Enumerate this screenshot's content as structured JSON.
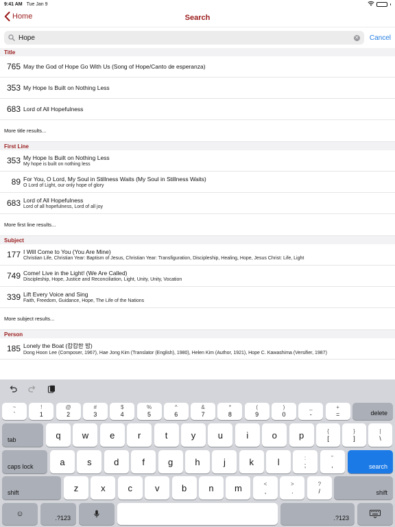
{
  "status_bar": {
    "time": "9:41 AM",
    "date": "Tue Jan 9"
  },
  "nav": {
    "back_label": "Home",
    "title": "Search"
  },
  "search": {
    "value": "Hope",
    "cancel_label": "Cancel"
  },
  "sections": [
    {
      "header": "Title",
      "rows": [
        {
          "num": "765",
          "title": "May the God of Hope Go With Us (Song of Hope/Canto de esperanza)",
          "sub": ""
        },
        {
          "num": "353",
          "title": "My Hope Is Built on Nothing Less",
          "sub": ""
        },
        {
          "num": "683",
          "title": "Lord of All Hopefulness",
          "sub": ""
        }
      ],
      "more": "More title results..."
    },
    {
      "header": "First Line",
      "rows": [
        {
          "num": "353",
          "title": "My Hope Is Built on Nothing Less",
          "sub": "My hope is built on nothing less"
        },
        {
          "num": "89",
          "title": "For You, O Lord, My Soul in Stillness Waits (My Soul in Stillness Waits)",
          "sub": "O Lord of Light, our only hope of glory"
        },
        {
          "num": "683",
          "title": "Lord of All Hopefulness",
          "sub": "Lord of all hopefulness, Lord of all joy"
        }
      ],
      "more": "More first line results..."
    },
    {
      "header": "Subject",
      "rows": [
        {
          "num": "177",
          "title": "I Will Come to You (You Are Mine)",
          "sub": "Christian Life, Christian Year: Baptism of Jesus, Christian Year: Transfiguration, Discipleship, Healing, Hope, Jesus Christ: Life, Light"
        },
        {
          "num": "749",
          "title": "Come! Live in the Light! (We Are Called)",
          "sub": "Discipleship, Hope, Justice and Reconciliation, Light, Unity, Unity, Vocation"
        },
        {
          "num": "339",
          "title": "Lift Every Voice and Sing",
          "sub": "Faith, Freedom, Guidance, Hope, The Life of the Nations"
        }
      ],
      "more": "More subject results..."
    },
    {
      "header": "Person",
      "rows": [
        {
          "num": "185",
          "title": "Lonely the Boat (캄캄한 밤)",
          "sub": "Dong Hoon Lee (Composer, 1967), Hae Jong Kim (Translator (English), 1980), Helen Kim (Author, 1921), Hope C. Kawashima (Versifier, 1987)"
        }
      ],
      "more": ""
    }
  ],
  "keyboard": {
    "row1": [
      {
        "top": "~",
        "bot": "`"
      },
      {
        "top": "!",
        "bot": "1"
      },
      {
        "top": "@",
        "bot": "2"
      },
      {
        "top": "#",
        "bot": "3"
      },
      {
        "top": "$",
        "bot": "4"
      },
      {
        "top": "%",
        "bot": "5"
      },
      {
        "top": "^",
        "bot": "6"
      },
      {
        "top": "&",
        "bot": "7"
      },
      {
        "top": "*",
        "bot": "8"
      },
      {
        "top": "(",
        "bot": "9"
      },
      {
        "top": ")",
        "bot": "0"
      },
      {
        "top": "_",
        "bot": "-"
      },
      {
        "top": "+",
        "bot": "="
      }
    ],
    "delete": "delete",
    "tab": "tab",
    "row2": [
      "q",
      "w",
      "e",
      "r",
      "t",
      "y",
      "u",
      "i",
      "o",
      "p"
    ],
    "row2_extra": [
      {
        "top": "{",
        "bot": "["
      },
      {
        "top": "}",
        "bot": "]"
      },
      {
        "top": "|",
        "bot": "\\"
      }
    ],
    "caps": "caps lock",
    "row3": [
      "a",
      "s",
      "d",
      "f",
      "g",
      "h",
      "j",
      "k",
      "l"
    ],
    "row3_extra": [
      {
        "top": ":",
        "bot": ";"
      },
      {
        "top": "”",
        "bot": ","
      }
    ],
    "search_key": "search",
    "shift": "shift",
    "row4": [
      "z",
      "x",
      "c",
      "v",
      "b",
      "n",
      "m"
    ],
    "row4_extra": [
      {
        "top": "<",
        "bot": ","
      },
      {
        "top": ">",
        "bot": "."
      },
      {
        "top": "?",
        "bot": "/"
      }
    ],
    "num_key": ".?123"
  },
  "colors": {
    "accent": "#9b1c1c",
    "link": "#1f7ae0",
    "search_key": "#1b7ae6"
  }
}
